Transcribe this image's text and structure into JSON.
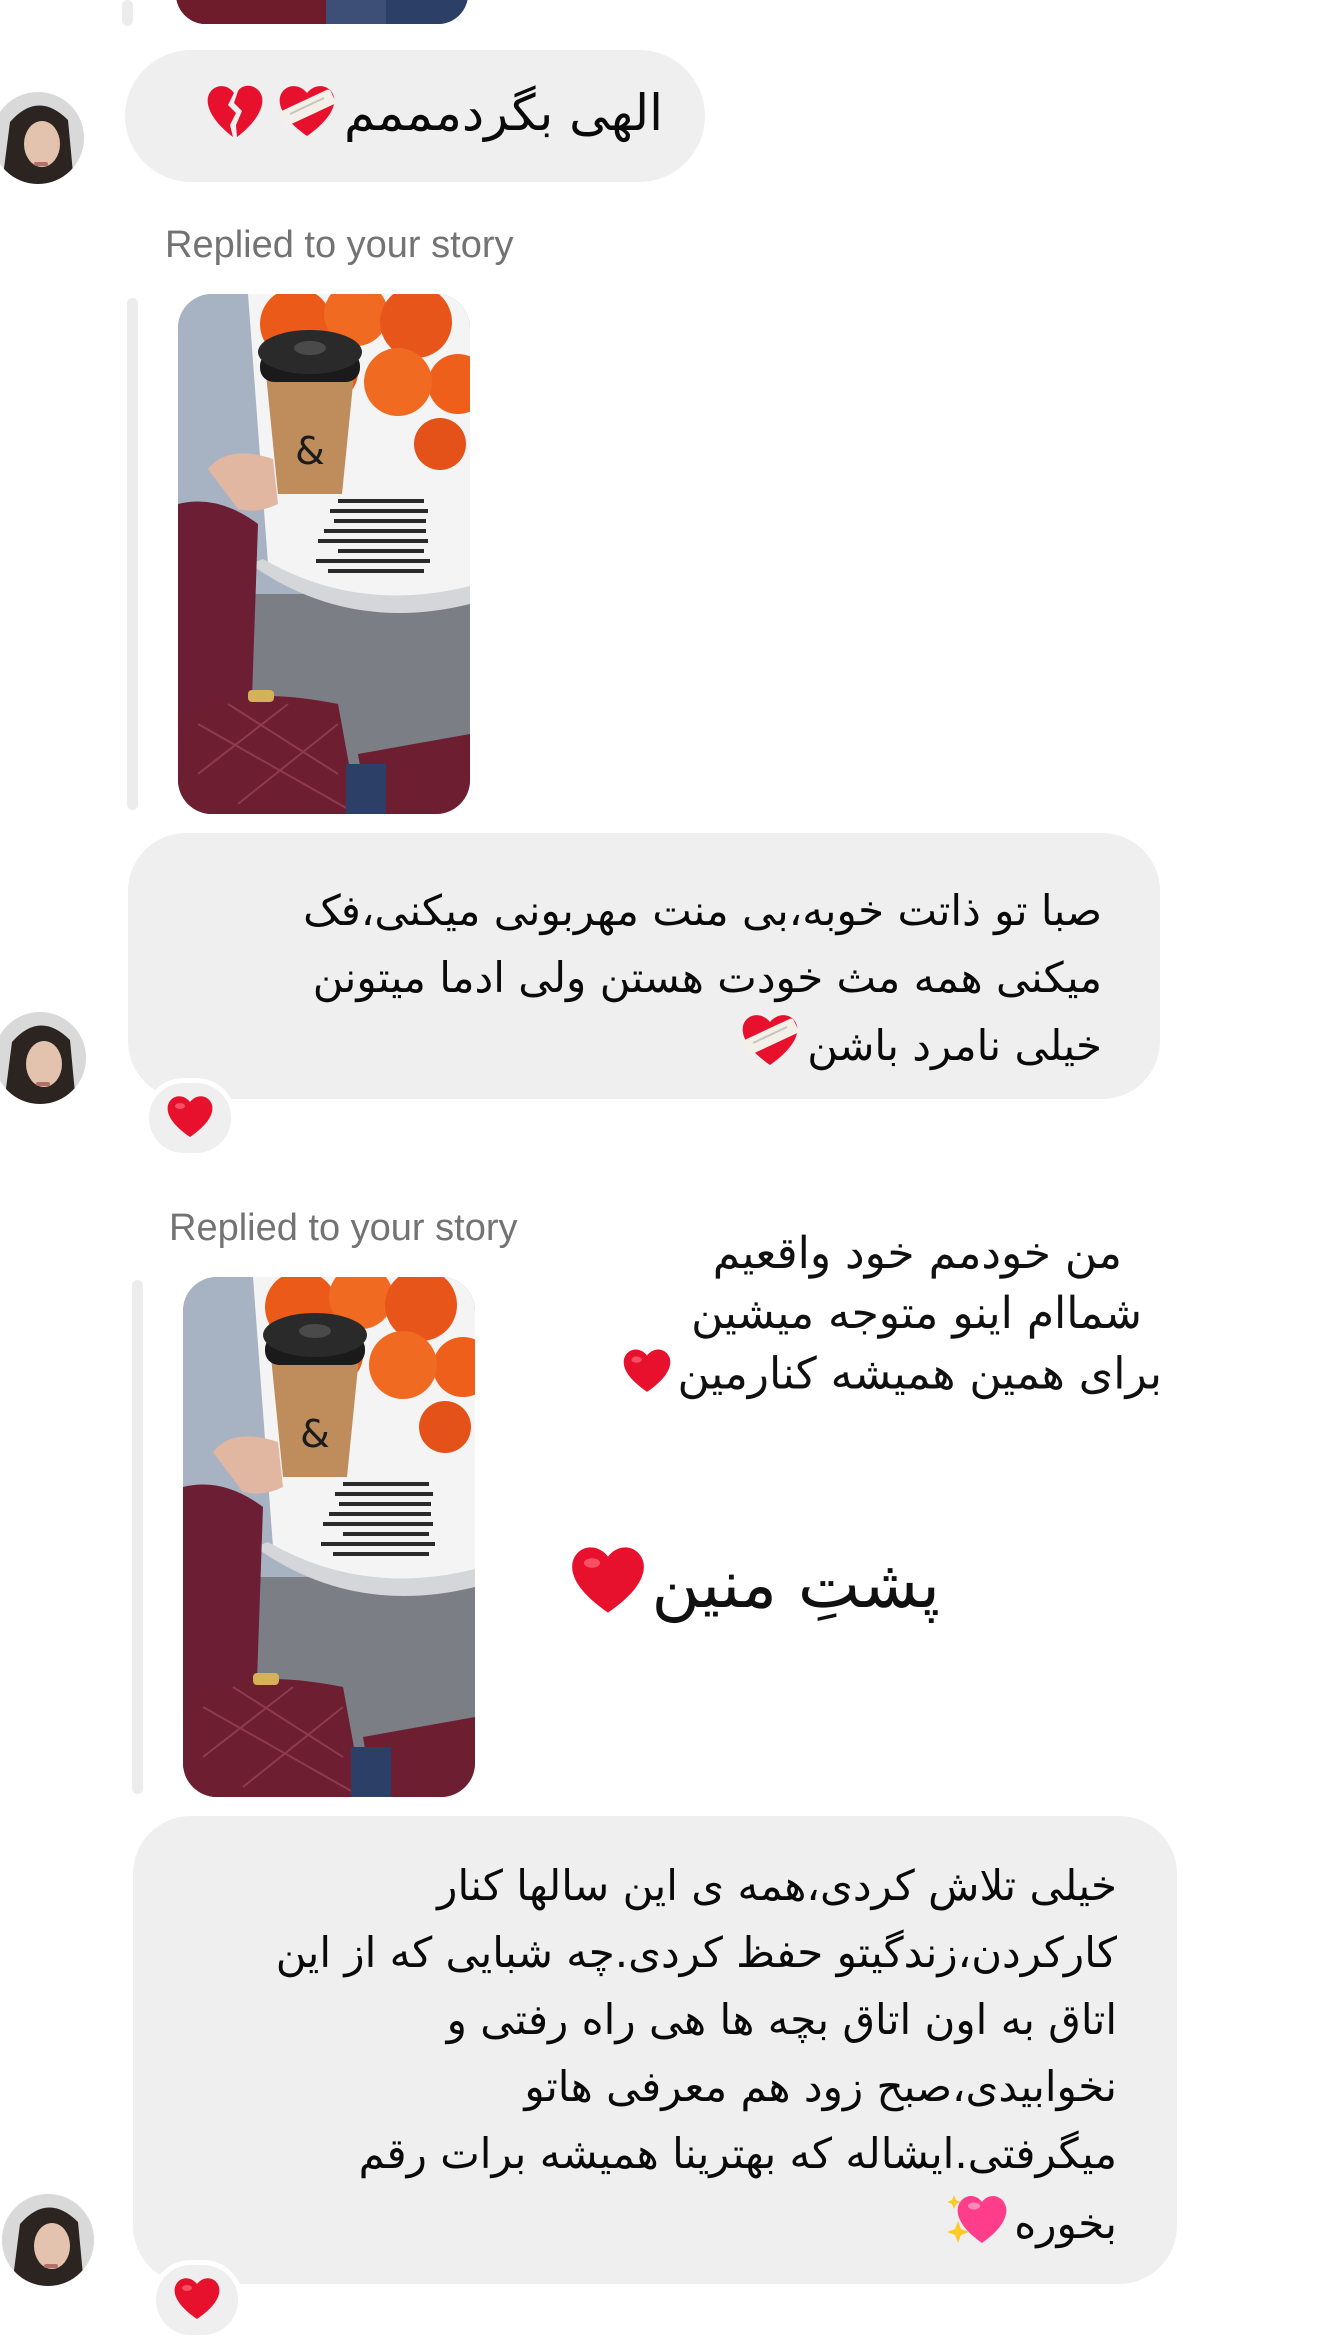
{
  "messages": {
    "first": {
      "line1": "الهی بگردمممم"
    },
    "reply1": {
      "label": "Replied to your story",
      "lines": [
        "صبا تو ذاتت خوبه،بی منت مهربونی میکنی،فک",
        "میکنی همه مث خودت هستن ولی ادما میتونن",
        "خیلی نامرد باشن"
      ],
      "reaction": "heart-icon"
    },
    "reply2": {
      "label": "Replied to your story",
      "overlay": {
        "line1": "من خودمم خود واقعیم",
        "line2": "شماام اینو متوجه میشین",
        "line3": "برای همین همیشه کنارمین",
        "line4": "پشتِ منین"
      },
      "lines": [
        "خیلی تلاش کردی،همه ی این سالها کنار",
        "کارکردن،زندگیتو حفظ کردی.چه شبایی که از این",
        "اتاق به اون اتاق بچه ها هی راه رفتی و",
        "نخوابیدی،صبح زود هم معرفی هاتو",
        "میگرفتی.ایشاله که بهترینا همیشه برات رقم",
        "بخوره"
      ],
      "reaction": "heart-icon"
    }
  },
  "colors": {
    "bubble": "#efefef",
    "label": "#737373",
    "heart": "#e8112d"
  }
}
